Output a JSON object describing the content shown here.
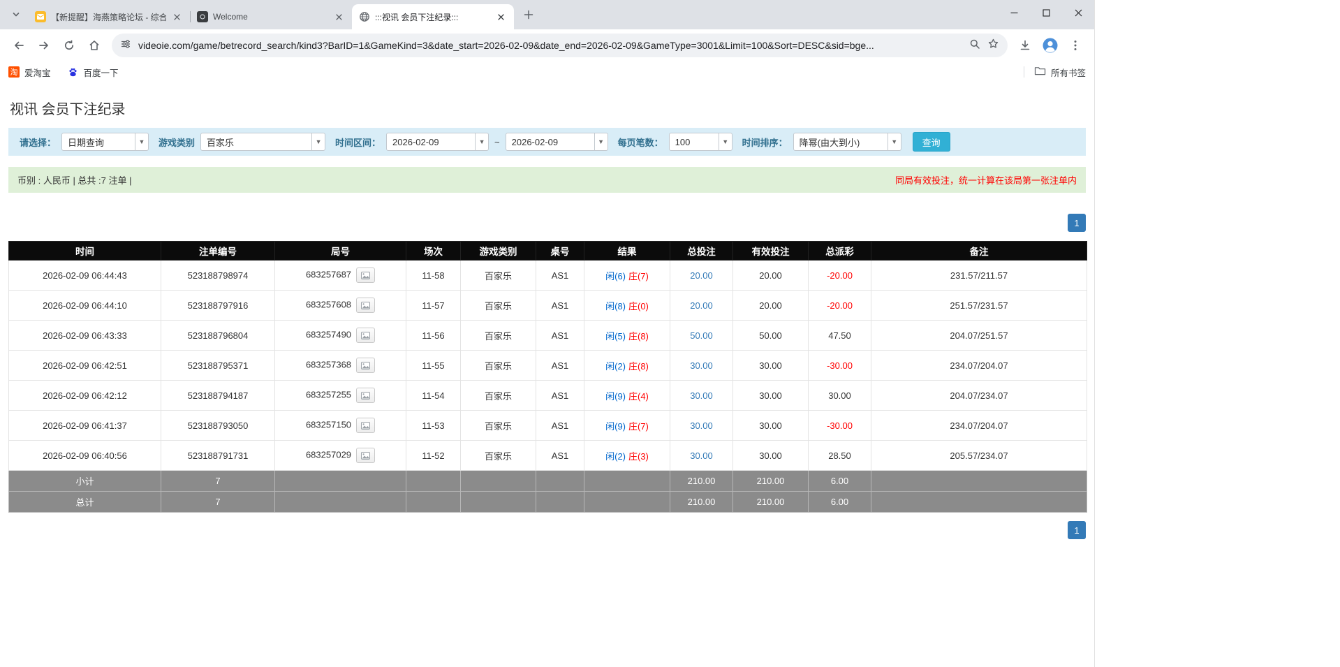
{
  "browser": {
    "tabs": [
      {
        "title": "【新提醒】海燕策略论坛 - 综合...",
        "icon": "forum-favicon"
      },
      {
        "title": "Welcome",
        "icon": "welcome-favicon"
      },
      {
        "title": ":::视讯 会员下注纪录:::",
        "icon": "globe-favicon"
      }
    ],
    "url": "videoie.com/game/betrecord_search/kind3?BarID=1&GameKind=3&date_start=2026-02-09&date_end=2026-02-09&GameType=3001&Limit=100&Sort=DESC&sid=bge...",
    "bookmarks": [
      {
        "label": "爱淘宝"
      },
      {
        "label": "百度一下"
      }
    ],
    "all_bookmarks_label": "所有书签"
  },
  "icons": {
    "tab_search": "chevron-down-icon",
    "back": "back-arrow-icon",
    "forward": "forward-arrow-icon",
    "reload": "reload-icon",
    "home": "home-icon",
    "site_info": "tune-icon",
    "zoom": "magnifier-icon",
    "bookmark_star": "star-icon",
    "download": "download-icon",
    "profile": "avatar-icon",
    "menu": "three-dots-icon",
    "all_bookmarks": "folder-icon",
    "roadmap": "roadmap-image-icon"
  },
  "page": {
    "title": "视讯 会员下注纪录",
    "filters": {
      "select_label": "请选择：",
      "select_value": "日期查询",
      "game_label": "游戏类别",
      "game_value": "百家乐",
      "range_label": "时间区间：",
      "date_start": "2026-02-09",
      "tilde": "~",
      "date_end": "2026-02-09",
      "per_page_label": "每页笔数：",
      "per_page_value": "100",
      "sort_label": "时间排序：",
      "sort_value": "降幂(由大到小)",
      "search_button": "查询"
    },
    "summary": {
      "left": "币别 : 人民币 | 总共 :7 注单 |",
      "right": "同局有效投注，统一计算在该局第一张注单内"
    },
    "pagination": {
      "page": "1"
    },
    "table": {
      "headers": [
        "时间",
        "注单编号",
        "局号",
        "场次",
        "游戏类别",
        "桌号",
        "结果",
        "总投注",
        "有效投注",
        "总派彩",
        "备注"
      ],
      "rows": [
        {
          "time": "2026-02-09 06:44:43",
          "bet_id": "523188798974",
          "round_id": "683257687",
          "session": "11-58",
          "game": "百家乐",
          "table_no": "AS1",
          "player": "闲(6)",
          "banker": "庄(7)",
          "total_bet": "20.00",
          "valid_bet": "20.00",
          "payout": "-20.00",
          "note": "231.57/211.57"
        },
        {
          "time": "2026-02-09 06:44:10",
          "bet_id": "523188797916",
          "round_id": "683257608",
          "session": "11-57",
          "game": "百家乐",
          "table_no": "AS1",
          "player": "闲(8)",
          "banker": "庄(0)",
          "total_bet": "20.00",
          "valid_bet": "20.00",
          "payout": "-20.00",
          "note": "251.57/231.57"
        },
        {
          "time": "2026-02-09 06:43:33",
          "bet_id": "523188796804",
          "round_id": "683257490",
          "session": "11-56",
          "game": "百家乐",
          "table_no": "AS1",
          "player": "闲(5)",
          "banker": "庄(8)",
          "total_bet": "50.00",
          "valid_bet": "50.00",
          "payout": "47.50",
          "note": "204.07/251.57"
        },
        {
          "time": "2026-02-09 06:42:51",
          "bet_id": "523188795371",
          "round_id": "683257368",
          "session": "11-55",
          "game": "百家乐",
          "table_no": "AS1",
          "player": "闲(2)",
          "banker": "庄(8)",
          "total_bet": "30.00",
          "valid_bet": "30.00",
          "payout": "-30.00",
          "note": "234.07/204.07"
        },
        {
          "time": "2026-02-09 06:42:12",
          "bet_id": "523188794187",
          "round_id": "683257255",
          "session": "11-54",
          "game": "百家乐",
          "table_no": "AS1",
          "player": "闲(9)",
          "banker": "庄(4)",
          "total_bet": "30.00",
          "valid_bet": "30.00",
          "payout": "30.00",
          "note": "204.07/234.07"
        },
        {
          "time": "2026-02-09 06:41:37",
          "bet_id": "523188793050",
          "round_id": "683257150",
          "session": "11-53",
          "game": "百家乐",
          "table_no": "AS1",
          "player": "闲(9)",
          "banker": "庄(7)",
          "total_bet": "30.00",
          "valid_bet": "30.00",
          "payout": "-30.00",
          "note": "234.07/204.07"
        },
        {
          "time": "2026-02-09 06:40:56",
          "bet_id": "523188791731",
          "round_id": "683257029",
          "session": "11-52",
          "game": "百家乐",
          "table_no": "AS1",
          "player": "闲(2)",
          "banker": "庄(3)",
          "total_bet": "30.00",
          "valid_bet": "30.00",
          "payout": "28.50",
          "note": "205.57/234.07"
        }
      ],
      "subtotal": {
        "label": "小计",
        "count": "7",
        "total_bet": "210.00",
        "valid_bet": "210.00",
        "payout": "6.00"
      },
      "total": {
        "label": "总计",
        "count": "7",
        "total_bet": "210.00",
        "valid_bet": "210.00",
        "payout": "6.00"
      }
    }
  }
}
